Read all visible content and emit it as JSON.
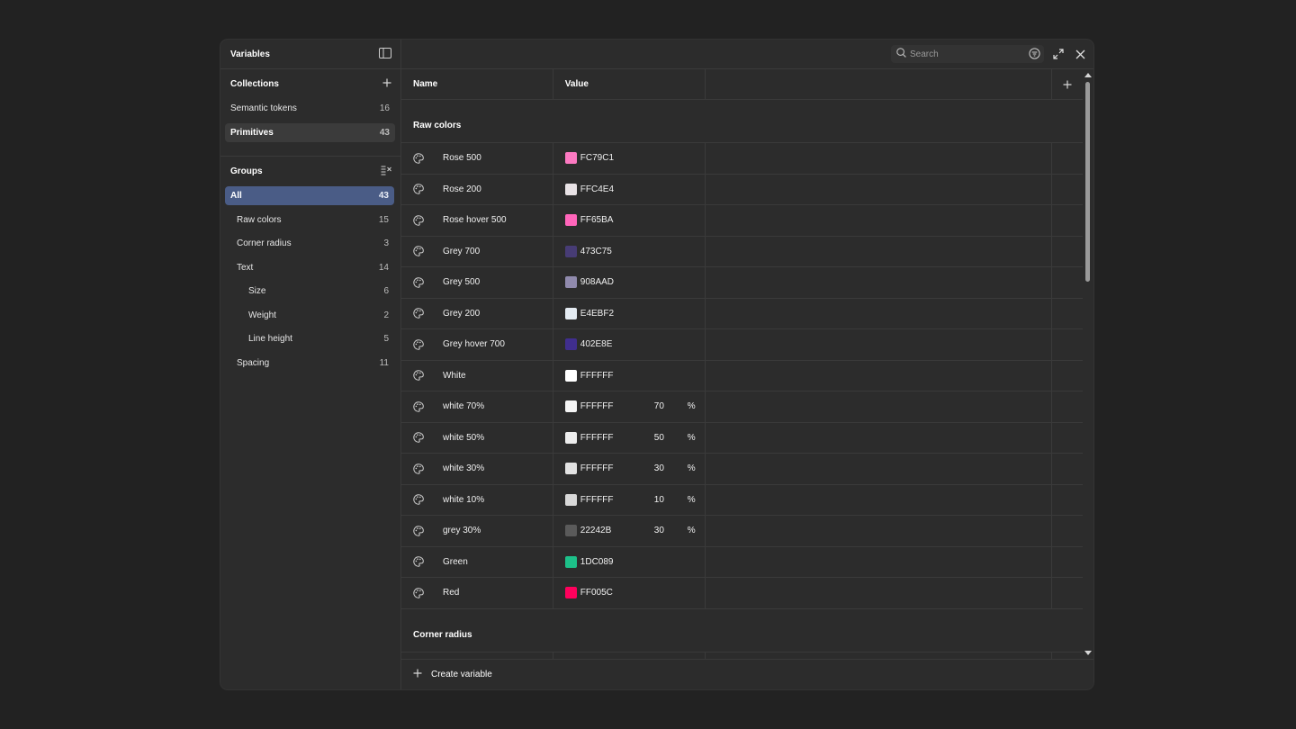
{
  "sidebar": {
    "title": "Variables",
    "collections_title": "Collections",
    "collections": [
      {
        "label": "Semantic tokens",
        "count": "16"
      },
      {
        "label": "Primitives",
        "count": "43"
      }
    ],
    "groups_title": "Groups",
    "groups": [
      {
        "label": "All",
        "count": "43"
      },
      {
        "label": "Raw colors",
        "count": "15"
      },
      {
        "label": "Corner radius",
        "count": "3"
      },
      {
        "label": "Text",
        "count": "14"
      },
      {
        "label": "Size",
        "count": "6"
      },
      {
        "label": "Weight",
        "count": "2"
      },
      {
        "label": "Line height",
        "count": "5"
      },
      {
        "label": "Spacing",
        "count": "11"
      }
    ]
  },
  "search": {
    "placeholder": "Search"
  },
  "table": {
    "headers": {
      "name": "Name",
      "value": "Value"
    },
    "group1": "Raw colors",
    "group2": "Corner radius",
    "rows": [
      {
        "name": "Rose 500",
        "hex": "FC79C1",
        "color": "#FC79C1",
        "alpha": "",
        "pct": ""
      },
      {
        "name": "Rose 200",
        "hex": "FFC4E4",
        "color": "#E8E2E5",
        "alpha": "",
        "pct": ""
      },
      {
        "name": "Rose hover 500",
        "hex": "FF65BA",
        "color": "#FF65BA",
        "alpha": "",
        "pct": ""
      },
      {
        "name": "Grey 700",
        "hex": "473C75",
        "color": "#473C75",
        "alpha": "",
        "pct": ""
      },
      {
        "name": "Grey 500",
        "hex": "908AAD",
        "color": "#908AAD",
        "alpha": "",
        "pct": ""
      },
      {
        "name": "Grey 200",
        "hex": "E4EBF2",
        "color": "#E4EBF2",
        "alpha": "",
        "pct": ""
      },
      {
        "name": "Grey hover 700",
        "hex": "402E8E",
        "color": "#402E8E",
        "alpha": "",
        "pct": ""
      },
      {
        "name": "White",
        "hex": "FFFFFF",
        "color": "#FFFFFF",
        "alpha": "",
        "pct": ""
      },
      {
        "name": "white 70%",
        "hex": "FFFFFF",
        "color": "#F4F4F4",
        "alpha": "70",
        "pct": "%"
      },
      {
        "name": "white 50%",
        "hex": "FFFFFF",
        "color": "#EDEDED",
        "alpha": "50",
        "pct": "%"
      },
      {
        "name": "white 30%",
        "hex": "FFFFFF",
        "color": "#E2E2E2",
        "alpha": "30",
        "pct": "%"
      },
      {
        "name": "white 10%",
        "hex": "FFFFFF",
        "color": "#D8D8D8",
        "alpha": "10",
        "pct": "%"
      },
      {
        "name": "grey 30%",
        "hex": "22242B",
        "color": "#5A5A5A",
        "alpha": "30",
        "pct": "%"
      },
      {
        "name": "Green",
        "hex": "1DC089",
        "color": "#1DC089",
        "alpha": "",
        "pct": ""
      },
      {
        "name": "Red",
        "hex": "FF005C",
        "color": "#FF005C",
        "alpha": "",
        "pct": ""
      }
    ]
  },
  "footer": {
    "create_label": "Create variable"
  }
}
